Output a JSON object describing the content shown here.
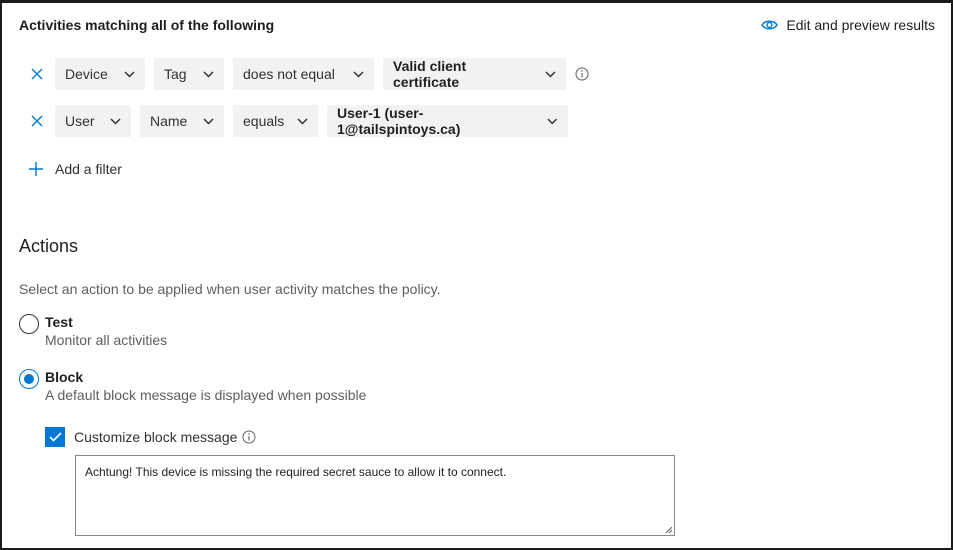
{
  "filters_section": {
    "title": "Activities matching all of the following",
    "preview_link": "Edit and preview results",
    "rows": [
      {
        "field": "Device",
        "property": "Tag",
        "operator": "does not equal",
        "value": "Valid client certificate",
        "has_info": true
      },
      {
        "field": "User",
        "property": "Name",
        "operator": "equals",
        "value": "User-1 (user-1@tailspintoys.ca)",
        "has_info": false
      }
    ],
    "add_filter_label": "Add a filter"
  },
  "actions_section": {
    "heading": "Actions",
    "description": "Select an action to be applied when user activity matches the policy.",
    "options": [
      {
        "label": "Test",
        "description": "Monitor all activities",
        "selected": false
      },
      {
        "label": "Block",
        "description": "A default block message is displayed when possible",
        "selected": true
      }
    ],
    "customize_checkbox": {
      "label": "Customize block message",
      "checked": true
    },
    "block_message": "Achtung!  This device is missing the required secret sauce to allow it to connect."
  },
  "colors": {
    "accent": "#0078d4",
    "dropdown_bg": "#f3f2f1",
    "text": "#323130"
  },
  "icons": {
    "remove": "close-icon",
    "preview": "eye-icon",
    "add": "plus-icon",
    "info": "info-icon",
    "chevron": "chevron-down-icon",
    "check": "checkmark-icon"
  }
}
